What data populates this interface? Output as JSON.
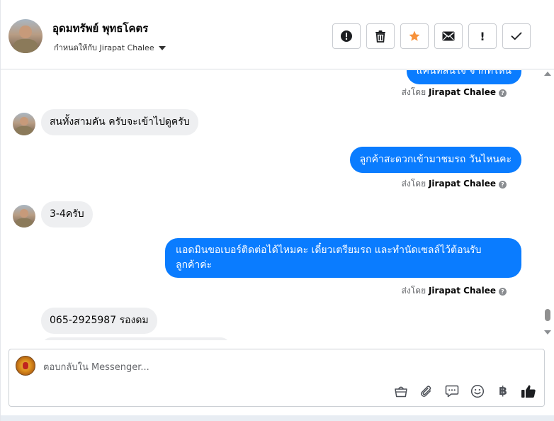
{
  "header": {
    "contact_name": "อุดมทรัพย์ พุทธโคตร",
    "assign_label": "กำหนดให้กับ Jirapat Chalee"
  },
  "actions": [
    {
      "name": "report",
      "icon": "alert-circle-icon"
    },
    {
      "name": "delete",
      "icon": "trash-icon"
    },
    {
      "name": "star",
      "icon": "star-icon",
      "color": "#f7923b"
    },
    {
      "name": "mark-unread",
      "icon": "envelope-icon"
    },
    {
      "name": "follow-up",
      "icon": "exclamation-icon",
      "label": "!"
    },
    {
      "name": "done",
      "icon": "checkmark-icon"
    }
  ],
  "messages": [
    {
      "from": "page",
      "text": "แคนที่สนใจ จากที่ไหน"
    },
    {
      "type": "sent_by",
      "prefix": "ส่งโดย",
      "name": "Jirapat Chalee"
    },
    {
      "from": "customer",
      "text": "สนทั้งสามคัน  ครับจะเข้าไปดูครับ"
    },
    {
      "from": "page",
      "text": "ลูกค้าสะดวกเข้ามาชมรถ วันไหนคะ"
    },
    {
      "type": "sent_by",
      "prefix": "ส่งโดย",
      "name": "Jirapat Chalee"
    },
    {
      "from": "customer",
      "text": "3-4ครับ"
    },
    {
      "from": "page",
      "text_line1": "แอดมินขอเบอร์ติดต่อได้ไหมคะ เดี๋ยวเตรียมรถ และทำนัดเซลล์ไว้ต้อนรับ",
      "text_line2": "ลูกค้าค่ะ"
    },
    {
      "type": "sent_by",
      "prefix": "ส่งโดย",
      "name": "Jirapat Chalee"
    },
    {
      "from": "customer",
      "text": "065-2925987 รองดม"
    }
  ],
  "composer": {
    "placeholder": "ตอบกลับใน Messenger...",
    "tools": [
      "shopping-basket-icon",
      "paperclip-icon",
      "saved-reply-icon",
      "emoji-icon",
      "baht-icon",
      "thumbs-up-icon"
    ],
    "baht_symbol": "฿"
  },
  "colors": {
    "outgoing_bubble": "#0a7cff",
    "incoming_bubble": "#eeeff1",
    "star": "#f7923b"
  }
}
